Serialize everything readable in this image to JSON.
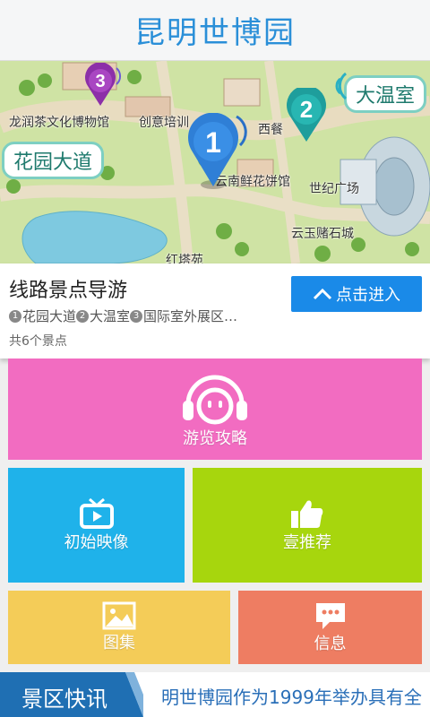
{
  "header": {
    "title": "昆明世博园"
  },
  "map": {
    "labels": {
      "tea_museum": "龙润茶文化博物馆",
      "training": "创意培训",
      "western_restaurant": "西餐",
      "flower_cake": "云南鲜花饼馆",
      "century_square": "世纪广场",
      "stone_city": "云玉赌石城",
      "red_tower": "红塔苑"
    },
    "callouts": {
      "garden_avenue": "花园大道",
      "greenhouse": "大温室"
    },
    "pins": [
      "1",
      "2",
      "3"
    ]
  },
  "route": {
    "title": "线路景点导游",
    "enter_label": "点击进入",
    "stops": [
      {
        "num": "1",
        "name": "花园大道"
      },
      {
        "num": "2",
        "name": "大温室"
      },
      {
        "num": "3",
        "name": "国际室外展区…"
      }
    ],
    "count": "共6个景点"
  },
  "tiles": {
    "guide": "游览攻略",
    "video": "初始映像",
    "recommend": "壹推荐",
    "gallery": "图集",
    "info": "信息"
  },
  "news": {
    "label": "景区快讯",
    "ticker": "明世博园作为1999年举办具有全"
  },
  "colors": {
    "header_title": "#2a8fd8",
    "enter_button": "#1a8ae8",
    "guide_tile": "#f26cc1",
    "video_tile": "#1fb2ea",
    "recommend_tile": "#a7d60d",
    "gallery_tile": "#f4cc58",
    "info_tile": "#ee7d62",
    "news_label": "#1f6fb3"
  }
}
